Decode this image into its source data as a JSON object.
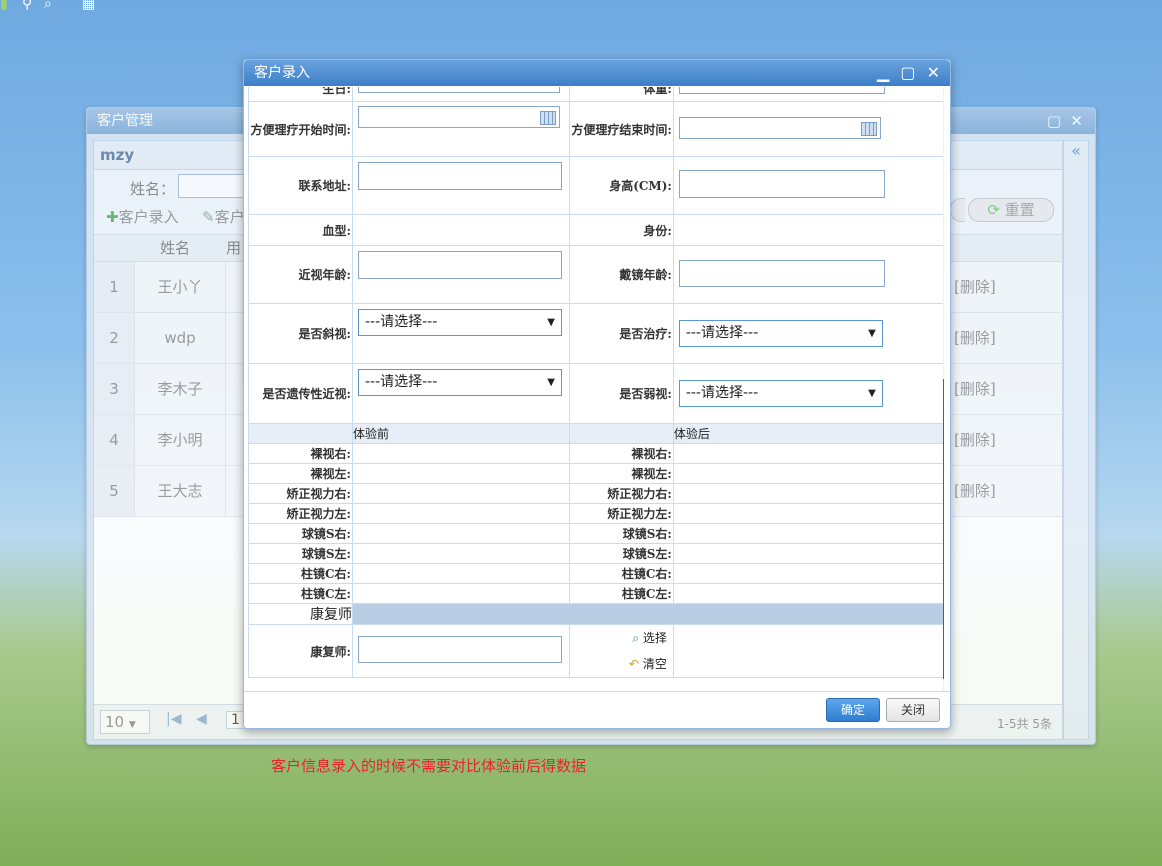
{
  "topbar": {
    "icons": [
      "user-icon",
      "search-icon",
      "calendar-grid-icon"
    ]
  },
  "bg_window": {
    "title": "客户管理",
    "panel_title": "mzy",
    "search": {
      "name_label": "姓名："
    },
    "actions": {
      "add": "客户录入",
      "edit": "客户"
    },
    "reset": "重置",
    "columns": {
      "name": "姓名",
      "use": "用"
    },
    "rows": [
      {
        "no": "1",
        "name": "王小丫",
        "op": "[删除]"
      },
      {
        "no": "2",
        "name": "wdp",
        "op": "[删除]"
      },
      {
        "no": "3",
        "name": "李木子",
        "op": "[删除]"
      },
      {
        "no": "4",
        "name": "李小明",
        "op": "[删除]"
      },
      {
        "no": "5",
        "name": "王大志",
        "op": "[删除]"
      }
    ],
    "pager": {
      "page_size": "10",
      "page": "1",
      "summary": "1-5共 5条"
    }
  },
  "dialog": {
    "title": "客户录入",
    "labels": {
      "birthday": "生日:",
      "weight": "体重:",
      "therapy_start": "方便理疗开始时间:",
      "therapy_end": "方便理疗结束时间:",
      "address": "联系地址:",
      "height": "身高(CM):",
      "blood": "血型:",
      "identity": "身份:",
      "myopia_age": "近视年龄:",
      "glasses_age": "戴镜年龄:",
      "strabismus": "是否斜视:",
      "treated": "是否治疗:",
      "hereditary": "是否遗传性近视:",
      "amblyopia": "是否弱视:"
    },
    "select_placeholder": "---请选择---",
    "before": "体验前",
    "after": "体验后",
    "vision_labels": [
      "裸视右:",
      "裸视左:",
      "矫正视力右:",
      "矫正视力左:",
      "球镜S右:",
      "球镜S左:",
      "柱镜C右:",
      "柱镜C左:"
    ],
    "therapist_section": "康复师",
    "therapist_label": "康复师:",
    "select_btn": "选择",
    "clear_btn": "清空",
    "ok": "确定",
    "close": "关闭"
  },
  "note": "客户信息录入的时候不需要对比体验前后得数据"
}
